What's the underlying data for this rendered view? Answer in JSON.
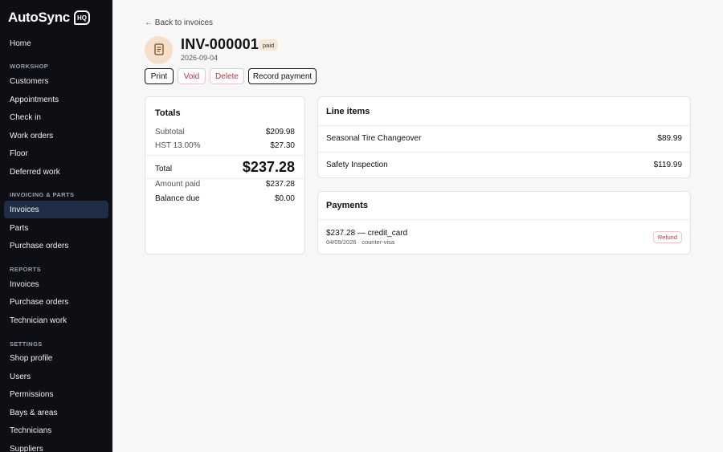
{
  "brand": {
    "name": "AutoSync",
    "badge": "HQ"
  },
  "sidebar": {
    "home": "Home",
    "workshop": {
      "title": "WORKSHOP",
      "items": [
        "Customers",
        "Appointments",
        "Check in",
        "Work orders",
        "Floor",
        "Deferred work"
      ]
    },
    "invoicing": {
      "title": "INVOICING & PARTS",
      "items": [
        "Invoices",
        "Parts",
        "Purchase orders"
      ]
    },
    "reports": {
      "title": "REPORTS",
      "items": [
        "Invoices",
        "Purchase orders",
        "Technician work"
      ]
    },
    "settings": {
      "title": "SETTINGS",
      "items": [
        "Shop profile",
        "Users",
        "Permissions",
        "Bays & areas",
        "Technicians",
        "Suppliers"
      ]
    }
  },
  "header": {
    "back_label": "← Back to invoices",
    "invoice_number": "INV-000001",
    "status": "paid",
    "date": "2026-09-04",
    "avatar_icon": "document-icon"
  },
  "actions": {
    "print": "Print",
    "void": "Void",
    "delete": "Delete",
    "record_payment": "Record payment"
  },
  "totals": {
    "title": "Totals",
    "subtotal_label": "Subtotal",
    "subtotal": "$209.98",
    "tax_label": "HST 13.00%",
    "tax": "$27.30",
    "total_label": "Total",
    "total": "$237.28",
    "amount_paid_label": "Amount paid",
    "amount_paid": "$237.28",
    "balance_due_label": "Balance due",
    "balance_due": "$0.00"
  },
  "line_items": {
    "title": "Line items",
    "items": [
      {
        "name": "Seasonal Tire Changeover",
        "amount": "$89.99"
      },
      {
        "name": "Safety Inspection",
        "amount": "$119.99"
      }
    ]
  },
  "payments": {
    "title": "Payments",
    "items": [
      {
        "summary": "$237.28 — credit_card",
        "detail": "04/09/2026 · counter-visa",
        "refund_label": "Refund"
      }
    ]
  },
  "colors": {
    "sidebar_bg": "#0d0f14",
    "active_nav": "#1f2d47",
    "danger": "#c4323f",
    "badge_bg": "#f6e8d7",
    "avatar_bg": "#f5dfca"
  }
}
